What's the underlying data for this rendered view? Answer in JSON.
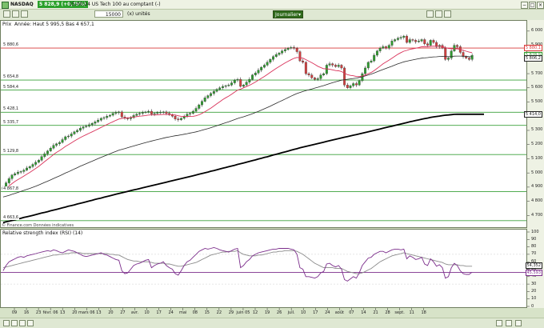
{
  "window": {
    "symbol": "NASDAQ",
    "price_badge": "5 828,9 (+0,75%)",
    "time_title": "15:00:24 US Tech 100 au comptant (-)",
    "toolbar": {
      "quantity": "15000",
      "units": "(x) unités",
      "period": "Journalier"
    }
  },
  "colors": {
    "background": "#d7e3c8",
    "ma_fast": "#d9325a",
    "ma_mid": "#2a2a2a",
    "ma_slow": "#000000",
    "rsi": "#7b2d8b",
    "rsi_signal": "#8a8a8a",
    "green_level": "#3aa03a",
    "red_level": "#d93a3a",
    "candle_up": "#2f9a2f",
    "candle_down": "#d04040"
  },
  "chart_data": [
    {
      "type": "candlestick",
      "title": "Prix",
      "legend_text": "Année: Haut 5 995,5 Bas 4 657,1",
      "ylim": [
        4640,
        6050
      ],
      "y_ticks": [
        4700,
        4800,
        4900,
        5000,
        5100,
        5200,
        5300,
        5400,
        5500,
        5600,
        5700,
        5800,
        5900,
        6000
      ],
      "x_labels": [
        "09",
        "16",
        "23",
        "févr. 06",
        "13",
        "20",
        "mars 06",
        "13",
        "20",
        "27",
        "avr.",
        "10",
        "17",
        "24",
        "mai",
        "08",
        "15",
        "22",
        "29",
        "juin 05",
        "12",
        "19",
        "26",
        "juil.",
        "10",
        "17",
        "24",
        "août",
        "07",
        "14",
        "21",
        "28",
        "sept.",
        "11",
        "18"
      ],
      "levels": [
        {
          "value": 5880.6,
          "label": "5 880,6",
          "color": "red"
        },
        {
          "value": 5654.8,
          "label": "5 654,8",
          "color": "green"
        },
        {
          "value": 5584.4,
          "label": "5 584,4",
          "color": "green"
        },
        {
          "value": 5428.1,
          "label": "5 428,1",
          "color": "green"
        },
        {
          "value": 5335.7,
          "label": "5 335,7",
          "color": "green"
        },
        {
          "value": 5129.8,
          "label": "5 129,8",
          "color": "green"
        },
        {
          "value": 4867.8,
          "label": "4 867,8",
          "color": "green"
        },
        {
          "value": 4663.6,
          "label": "4 663,6",
          "color": "green"
        }
      ],
      "right_tags": [
        {
          "value": 5880.1,
          "label": "5 880,1",
          "color": "red"
        },
        {
          "value": 5828.9,
          "label": "5 828,9",
          "color": "green"
        },
        {
          "value": 5806.2,
          "label": "5 806,2",
          "color": "black"
        },
        {
          "value": 5414.0,
          "label": "5 414,0",
          "color": "black"
        }
      ],
      "close": [
        4900,
        4930,
        4960,
        4985,
        4995,
        5005,
        5010,
        5020,
        5035,
        5045,
        5060,
        5075,
        5090,
        5115,
        5135,
        5155,
        5175,
        5195,
        5205,
        5215,
        5235,
        5255,
        5260,
        5275,
        5290,
        5300,
        5315,
        5325,
        5330,
        5340,
        5350,
        5360,
        5372,
        5385,
        5390,
        5400,
        5407,
        5420,
        5425,
        5430,
        5395,
        5385,
        5382,
        5390,
        5405,
        5415,
        5420,
        5425,
        5430,
        5435,
        5415,
        5420,
        5425,
        5428,
        5430,
        5420,
        5410,
        5400,
        5380,
        5375,
        5385,
        5400,
        5415,
        5420,
        5435,
        5455,
        5480,
        5505,
        5530,
        5545,
        5560,
        5575,
        5590,
        5600,
        5610,
        5615,
        5620,
        5635,
        5655,
        5660,
        5610,
        5620,
        5640,
        5660,
        5690,
        5705,
        5725,
        5745,
        5760,
        5780,
        5800,
        5820,
        5835,
        5845,
        5860,
        5870,
        5880,
        5885,
        5880,
        5855,
        5790,
        5780,
        5700,
        5690,
        5670,
        5660,
        5665,
        5690,
        5700,
        5760,
        5770,
        5760,
        5750,
        5760,
        5740,
        5620,
        5600,
        5615,
        5630,
        5620,
        5650,
        5700,
        5740,
        5780,
        5790,
        5830,
        5860,
        5880,
        5890,
        5880,
        5900,
        5930,
        5940,
        5950,
        5955,
        5965,
        5920,
        5940,
        5935,
        5925,
        5930,
        5940,
        5910,
        5900,
        5935,
        5920,
        5890,
        5900,
        5880,
        5800,
        5810,
        5860,
        5900,
        5890,
        5850,
        5820,
        5810,
        5800,
        5829
      ],
      "ma_fast": [
        4878,
        4892,
        4908,
        4925,
        4940,
        4953,
        4965,
        4978,
        4991,
        5004,
        5018,
        5032,
        5046,
        5063,
        5080,
        5096,
        5112,
        5130,
        5145,
        5158,
        5172,
        5187,
        5199,
        5212,
        5225,
        5237,
        5249,
        5260,
        5270,
        5280,
        5290,
        5300,
        5310,
        5321,
        5331,
        5341,
        5351,
        5361,
        5371,
        5380,
        5384,
        5387,
        5389,
        5391,
        5394,
        5397,
        5400,
        5402,
        5405,
        5408,
        5409,
        5409,
        5410,
        5411,
        5412,
        5413,
        5412,
        5411,
        5408,
        5403,
        5399,
        5398,
        5398,
        5398,
        5399,
        5403,
        5410,
        5420,
        5432,
        5444,
        5457,
        5472,
        5487,
        5502,
        5517,
        5530,
        5542,
        5555,
        5570,
        5584,
        5591,
        5600,
        5609,
        5618,
        5629,
        5641,
        5654,
        5667,
        5680,
        5694,
        5709,
        5723,
        5737,
        5750,
        5763,
        5776,
        5787,
        5798,
        5808,
        5814,
        5812,
        5809,
        5799,
        5788,
        5777,
        5765,
        5752,
        5743,
        5735,
        5734,
        5731,
        5727,
        5722,
        5720,
        5715,
        5703,
        5693,
        5688,
        5685,
        5680,
        5679,
        5683,
        5690,
        5699,
        5708,
        5722,
        5737,
        5753,
        5769,
        5782,
        5795,
        5809,
        5823,
        5837,
        5848,
        5858,
        5864,
        5871,
        5875,
        5879,
        5884,
        5889,
        5890,
        5889,
        5892,
        5894,
        5893,
        5893,
        5891,
        5884,
        5878,
        5876,
        5876,
        5875,
        5871,
        5865,
        5858,
        5852,
        5848
      ],
      "ma_mid": [
        4830,
        4836,
        4842,
        4849,
        4856,
        4863,
        4870,
        4877,
        4884,
        4891,
        4899,
        4907,
        4915,
        4924,
        4933,
        4942,
        4951,
        4961,
        4970,
        4979,
        4989,
        4999,
        5008,
        5018,
        5028,
        5037,
        5047,
        5056,
        5065,
        5074,
        5083,
        5092,
        5101,
        5110,
        5118,
        5127,
        5135,
        5144,
        5152,
        5160,
        5166,
        5172,
        5178,
        5184,
        5190,
        5196,
        5202,
        5208,
        5214,
        5220,
        5225,
        5230,
        5235,
        5240,
        5245,
        5250,
        5254,
        5258,
        5262,
        5265,
        5269,
        5273,
        5277,
        5281,
        5285,
        5290,
        5295,
        5301,
        5307,
        5313,
        5319,
        5326,
        5333,
        5340,
        5347,
        5354,
        5361,
        5368,
        5376,
        5384,
        5390,
        5396,
        5403,
        5410,
        5418,
        5426,
        5434,
        5443,
        5452,
        5461,
        5471,
        5481,
        5491,
        5501,
        5511,
        5521,
        5531,
        5541,
        5551,
        5560,
        5567,
        5574,
        5580,
        5586,
        5592,
        5598,
        5604,
        5610,
        5616,
        5623,
        5630,
        5636,
        5642,
        5648,
        5654,
        5657,
        5660,
        5663,
        5666,
        5669,
        5673,
        5678,
        5684,
        5690,
        5697,
        5705,
        5713,
        5721,
        5729,
        5737,
        5745,
        5753,
        5761,
        5769,
        5776,
        5783,
        5788,
        5793,
        5797,
        5801,
        5805,
        5809,
        5811,
        5813,
        5816,
        5818,
        5819,
        5821,
        5822,
        5821,
        5820,
        5821,
        5823,
        5824,
        5824,
        5823,
        5822,
        5820,
        5819
      ],
      "ma_slow": [
        4650,
        4655,
        4660,
        4665,
        4670,
        4675,
        4680,
        4686,
        4691,
        4696,
        4701,
        4706,
        4712,
        4717,
        4722,
        4727,
        4733,
        4738,
        4743,
        4749,
        4754,
        4759,
        4765,
        4770,
        4775,
        4781,
        4786,
        4791,
        4797,
        4802,
        4807,
        4813,
        4818,
        4823,
        4829,
        4834,
        4839,
        4845,
        4850,
        4855,
        4860,
        4865,
        4870,
        4875,
        4880,
        4885,
        4890,
        4895,
        4900,
        4905,
        4910,
        4915,
        4920,
        4925,
        4930,
        4935,
        4940,
        4945,
        4950,
        4955,
        4960,
        4965,
        4970,
        4975,
        4980,
        4985,
        4991,
        4996,
        5001,
        5006,
        5012,
        5017,
        5022,
        5028,
        5033,
        5038,
        5044,
        5049,
        5054,
        5060,
        5065,
        5070,
        5076,
        5081,
        5087,
        5092,
        5098,
        5103,
        5109,
        5114,
        5120,
        5126,
        5131,
        5137,
        5143,
        5148,
        5154,
        5160,
        5166,
        5171,
        5177,
        5182,
        5187,
        5192,
        5197,
        5202,
        5207,
        5212,
        5217,
        5222,
        5227,
        5232,
        5237,
        5242,
        5247,
        5252,
        5256,
        5261,
        5266,
        5270,
        5275,
        5280,
        5285,
        5290,
        5295,
        5300,
        5305,
        5310,
        5315,
        5320,
        5325,
        5330,
        5335,
        5340,
        5345,
        5350,
        5355,
        5360,
        5365,
        5370,
        5374,
        5379,
        5383,
        5387,
        5391,
        5395,
        5398,
        5401,
        5404,
        5407,
        5409,
        5411,
        5413,
        5414,
        5414,
        5414,
        5414,
        5414,
        5414,
        5414,
        5414,
        5414,
        5414
      ]
    },
    {
      "type": "line",
      "title": "Relative strength index (RSI) (14)",
      "ylim": [
        0,
        100
      ],
      "y_ticks": [
        0,
        10,
        20,
        30,
        40,
        50,
        60,
        70,
        80,
        90,
        100
      ],
      "right_tags": [
        {
          "value": 54.352,
          "label": "54,352",
          "color": "black"
        },
        {
          "value": 45.593,
          "label": "45,593",
          "color": "purple"
        }
      ],
      "level_line": 45.593,
      "series": [
        {
          "name": "RSI",
          "values": [
            48,
            55,
            60,
            62,
            64,
            66,
            67,
            66,
            68,
            69,
            70,
            71,
            72,
            73,
            74,
            75,
            74,
            76,
            75,
            73,
            72,
            74,
            76,
            75,
            74,
            72,
            70,
            68,
            67,
            68,
            69,
            70,
            71,
            72,
            70,
            69,
            67,
            65,
            63,
            62,
            48,
            44,
            45,
            50,
            55,
            57,
            58,
            60,
            62,
            63,
            52,
            55,
            57,
            58,
            60,
            55,
            52,
            50,
            44,
            42,
            48,
            55,
            60,
            62,
            66,
            70,
            74,
            76,
            78,
            77,
            78,
            79,
            78,
            76,
            75,
            74,
            73,
            75,
            77,
            78,
            52,
            55,
            60,
            63,
            68,
            70,
            72,
            73,
            74,
            75,
            76,
            77,
            77,
            78,
            78,
            78,
            78,
            77,
            76,
            70,
            52,
            50,
            40,
            40,
            39,
            38,
            40,
            45,
            47,
            57,
            58,
            55,
            53,
            55,
            50,
            36,
            34,
            37,
            40,
            38,
            45,
            55,
            60,
            65,
            66,
            70,
            72,
            74,
            74,
            72,
            74,
            76,
            77,
            77,
            76,
            77,
            64,
            68,
            66,
            63,
            64,
            66,
            57,
            55,
            64,
            60,
            54,
            56,
            52,
            38,
            40,
            52,
            58,
            55,
            48,
            44,
            43,
            43,
            46
          ]
        },
        {
          "name": "Signal",
          "values": [
            52,
            53,
            54,
            55,
            56,
            57,
            58,
            59,
            60,
            61,
            62,
            63,
            64,
            65,
            66,
            67,
            68,
            69,
            69,
            70,
            70,
            71,
            71,
            72,
            72,
            72,
            72,
            71,
            71,
            71,
            71,
            71,
            71,
            71,
            71,
            71,
            70,
            70,
            69,
            69,
            67,
            65,
            63,
            62,
            61,
            61,
            60,
            60,
            60,
            60,
            59,
            58,
            58,
            58,
            58,
            57,
            57,
            56,
            55,
            54,
            54,
            55,
            56,
            57,
            58,
            59,
            61,
            63,
            65,
            67,
            69,
            70,
            71,
            72,
            73,
            73,
            74,
            74,
            74,
            75,
            72,
            70,
            69,
            68,
            68,
            68,
            69,
            69,
            70,
            71,
            72,
            73,
            73,
            74,
            74,
            75,
            75,
            75,
            75,
            74,
            72,
            70,
            67,
            64,
            61,
            58,
            56,
            54,
            52,
            52,
            52,
            52,
            51,
            51,
            51,
            49,
            47,
            46,
            45,
            44,
            44,
            45,
            47,
            49,
            51,
            54,
            57,
            60,
            62,
            64,
            66,
            68,
            69,
            70,
            71,
            72,
            71,
            70,
            69,
            68,
            67,
            66,
            65,
            64,
            63,
            62,
            61,
            60,
            59,
            57,
            56,
            56,
            56,
            56,
            55,
            55,
            54,
            54,
            54
          ]
        }
      ]
    }
  ],
  "footer": {
    "source": "© Finance.com Données indicatives"
  }
}
